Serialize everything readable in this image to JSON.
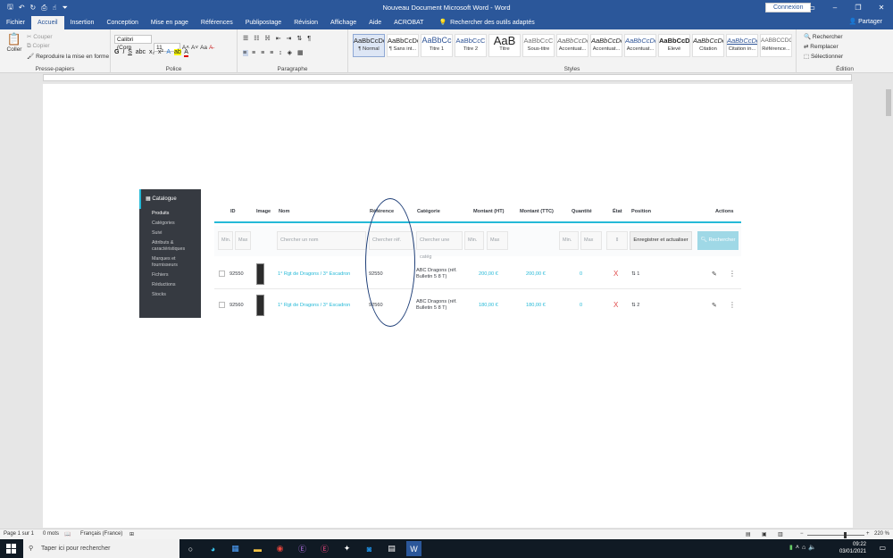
{
  "window": {
    "title": "Nouveau Document Microsoft Word  -  Word",
    "connexion_label": "Connexion",
    "share_label": "Partager"
  },
  "ribbon_tabs": [
    "Fichier",
    "Accueil",
    "Insertion",
    "Conception",
    "Mise en page",
    "Références",
    "Publipostage",
    "Révision",
    "Affichage",
    "Aide",
    "ACROBAT"
  ],
  "active_tab": "Accueil",
  "tell_me": "Rechercher des outils adaptés",
  "clipboard": {
    "paste": "Coller",
    "cut": "Couper",
    "copy": "Copier",
    "format_painter": "Reproduire la mise en forme",
    "group": "Presse-papiers"
  },
  "font": {
    "name": "Calibri (Corp",
    "size": "11",
    "group": "Police"
  },
  "paragraph_group": "Paragraphe",
  "styles": {
    "group": "Styles",
    "items": [
      {
        "sample": "AaBbCcDc",
        "name": "¶ Normal"
      },
      {
        "sample": "AaBbCcDc",
        "name": "¶ Sans int..."
      },
      {
        "sample": "AaBbCc",
        "name": "Titre 1"
      },
      {
        "sample": "AaBbCcC",
        "name": "Titre 2"
      },
      {
        "sample": "AaB",
        "name": "Titre"
      },
      {
        "sample": "AaBbCcC",
        "name": "Sous-titre"
      },
      {
        "sample": "AaBbCcDc",
        "name": "Accentuat..."
      },
      {
        "sample": "AaBbCcDc",
        "name": "Accentuat..."
      },
      {
        "sample": "AaBbCcDc",
        "name": "Accentuat..."
      },
      {
        "sample": "AaBbCcDc",
        "name": "Élevé"
      },
      {
        "sample": "AaBbCcDc",
        "name": "Citation"
      },
      {
        "sample": "AaBbCcDc",
        "name": "Citation in..."
      },
      {
        "sample": "AABBCCDC",
        "name": "Référence..."
      }
    ]
  },
  "editing": {
    "find": "Rechercher",
    "replace": "Remplacer",
    "select": "Sélectionner",
    "group": "Édition"
  },
  "embedded": {
    "sidebar": {
      "header": "Catalogue",
      "items": [
        "Produits",
        "Catégories",
        "Suivi",
        "Attributs & caractéristiques",
        "Marques et fournisseurs",
        "Fichiers",
        "Réductions",
        "Stocks"
      ]
    },
    "columns": [
      "ID",
      "Image",
      "Nom",
      "Référence",
      "Catégorie",
      "Montant (HT)",
      "Montant (TTC)",
      "Quantité",
      "État",
      "Position",
      "Actions"
    ],
    "filters": {
      "min": "Min.",
      "max": "Max",
      "name_placeholder": "Chercher un nom",
      "ref_placeholder": "Chercher réf.",
      "cat_placeholder": "Chercher une catég",
      "save_button": "Enregistrer et actualiser",
      "search_button": "Rechercher"
    },
    "rows": [
      {
        "id": "92550",
        "name": "1° Rgt de Dragons / 3° Escadron",
        "reference": "92550",
        "category": "ABC Dragons (réf. Bulletin 5 8 T)",
        "price_ht": "200,00 €",
        "price_ttc": "200,00 €",
        "quantity": "0",
        "state": "X",
        "position": "1"
      },
      {
        "id": "92560",
        "name": "1° Rgt de Dragons / 3° Escadron",
        "reference": "92560",
        "category": "ABC Dragons (réf. Bulletin 5 8 T)",
        "price_ht": "180,00 €",
        "price_ttc": "180,00 €",
        "quantity": "0",
        "state": "X",
        "position": "2"
      }
    ]
  },
  "status": {
    "page": "Page 1 sur 1",
    "words": "0 mots",
    "language": "Français (France)",
    "zoom": "220 %"
  },
  "taskbar": {
    "search_placeholder": "Taper ici pour rechercher",
    "time": "09:22",
    "date": "03/01/2021"
  },
  "colors": {
    "word_blue": "#2b579a",
    "prestashop_accent": "#25b9d7",
    "state_red": "#e04a4a",
    "annotation_oval": "#1f3f78"
  }
}
